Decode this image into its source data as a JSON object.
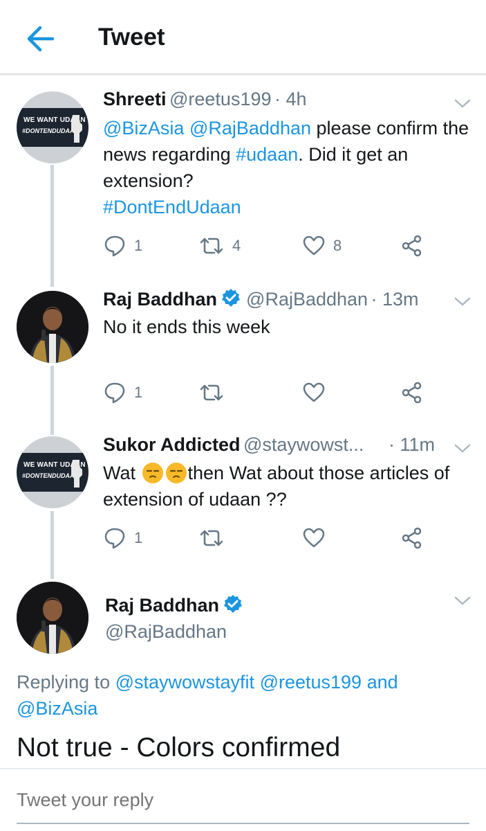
{
  "header": {
    "title": "Tweet",
    "back_icon": "arrow-left-icon"
  },
  "colors": {
    "accent": "#1b95e0",
    "text": "#14171a",
    "muted": "#657786",
    "thread": "#ccd6dd"
  },
  "tweets": [
    {
      "name": "Shreeti",
      "handle": "@reetus199",
      "time": "· 4h",
      "avatar": {
        "line1": "WE WANT UDAAN",
        "line2": "#DONTENDUDAAN"
      },
      "text": [
        {
          "t": "@BizAsia",
          "link": true
        },
        {
          "t": " ",
          "link": false
        },
        {
          "t": "@RajBaddhan",
          "link": true
        },
        {
          "t": " please confirm the news regarding ",
          "link": false
        },
        {
          "t": "#udaan",
          "link": true
        },
        {
          "t": ". Did it get an extension?",
          "link": false
        }
      ],
      "hashtag": "#DontEndUdaan",
      "counts": {
        "reply": "1",
        "retweet": "4",
        "like": "8"
      }
    },
    {
      "name": "Raj Baddhan",
      "handle": "@RajBaddhan",
      "time": "· 13m",
      "text_plain": "No it ends this week",
      "counts": {
        "reply": "1",
        "retweet": "",
        "like": ""
      }
    },
    {
      "name": "Sukor Addicted",
      "handle": "@staywowst...",
      "time": "· 11m",
      "avatar": {
        "line1": "WE WANT UDAAN",
        "line2": "#DONTENDUDAAN"
      },
      "text_a": "Wat ",
      "text_b": "then Wat about those articles of extension of udaan ??",
      "emoji": "unamused-face-icon",
      "counts": {
        "reply": "1",
        "retweet": "",
        "like": ""
      }
    }
  ],
  "main": {
    "name": "Raj Baddhan",
    "handle": "@RajBaddhan",
    "replying_prefix": "Replying to ",
    "replying_users": [
      "@staywowstayfit",
      "@reetus199"
    ],
    "replying_and": " and ",
    "replying_last": "@BizAsia",
    "text": "Not true - Colors confirmed"
  },
  "reply": {
    "placeholder": "Tweet your reply"
  }
}
